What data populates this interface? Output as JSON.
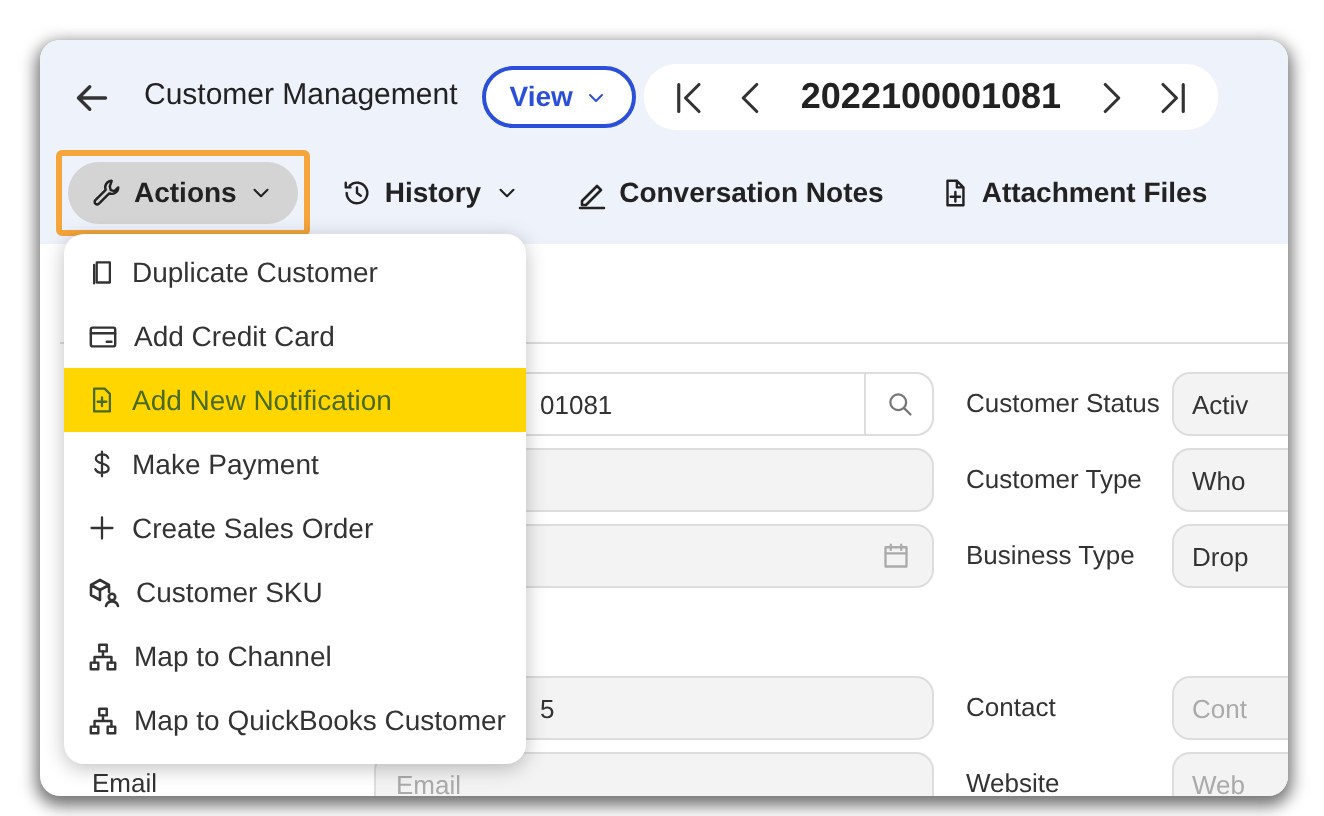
{
  "header": {
    "title": "Customer Management",
    "view_button": "View",
    "record_number": "2022100001081"
  },
  "toolbar": [
    {
      "label": "Actions",
      "focused": true,
      "has_menu": true
    },
    {
      "label": "History",
      "focused": false,
      "has_menu": true
    },
    {
      "label": "Conversation Notes",
      "focused": false,
      "has_menu": false
    },
    {
      "label": "Attachment Files",
      "focused": false,
      "has_menu": false
    }
  ],
  "actions_menu": [
    {
      "label": "Duplicate Customer",
      "selected": false
    },
    {
      "label": "Add Credit Card",
      "selected": false
    },
    {
      "label": "Add New Notification",
      "selected": true
    },
    {
      "label": "Make Payment",
      "selected": false
    },
    {
      "label": "Create Sales Order",
      "selected": false
    },
    {
      "label": "Customer SKU",
      "selected": false
    },
    {
      "label": "Map to Channel",
      "selected": false
    },
    {
      "label": "Map to QuickBooks Customer",
      "selected": false
    }
  ],
  "form_left": [
    {
      "kind": "search",
      "value": "01081"
    },
    {
      "kind": "text"
    },
    {
      "kind": "date"
    },
    {
      "kind": "text",
      "value": "5"
    },
    {
      "kind": "text",
      "label": "Email",
      "placeholder": "Email"
    }
  ],
  "form_right": [
    {
      "label": "Customer Status",
      "value": "Activ"
    },
    {
      "label": "Customer Type",
      "value": "Who"
    },
    {
      "label": "Business Type",
      "value": "Drop"
    },
    {
      "label": "Contact",
      "placeholder": "Cont"
    },
    {
      "label": "Website",
      "placeholder": "Web"
    }
  ]
}
